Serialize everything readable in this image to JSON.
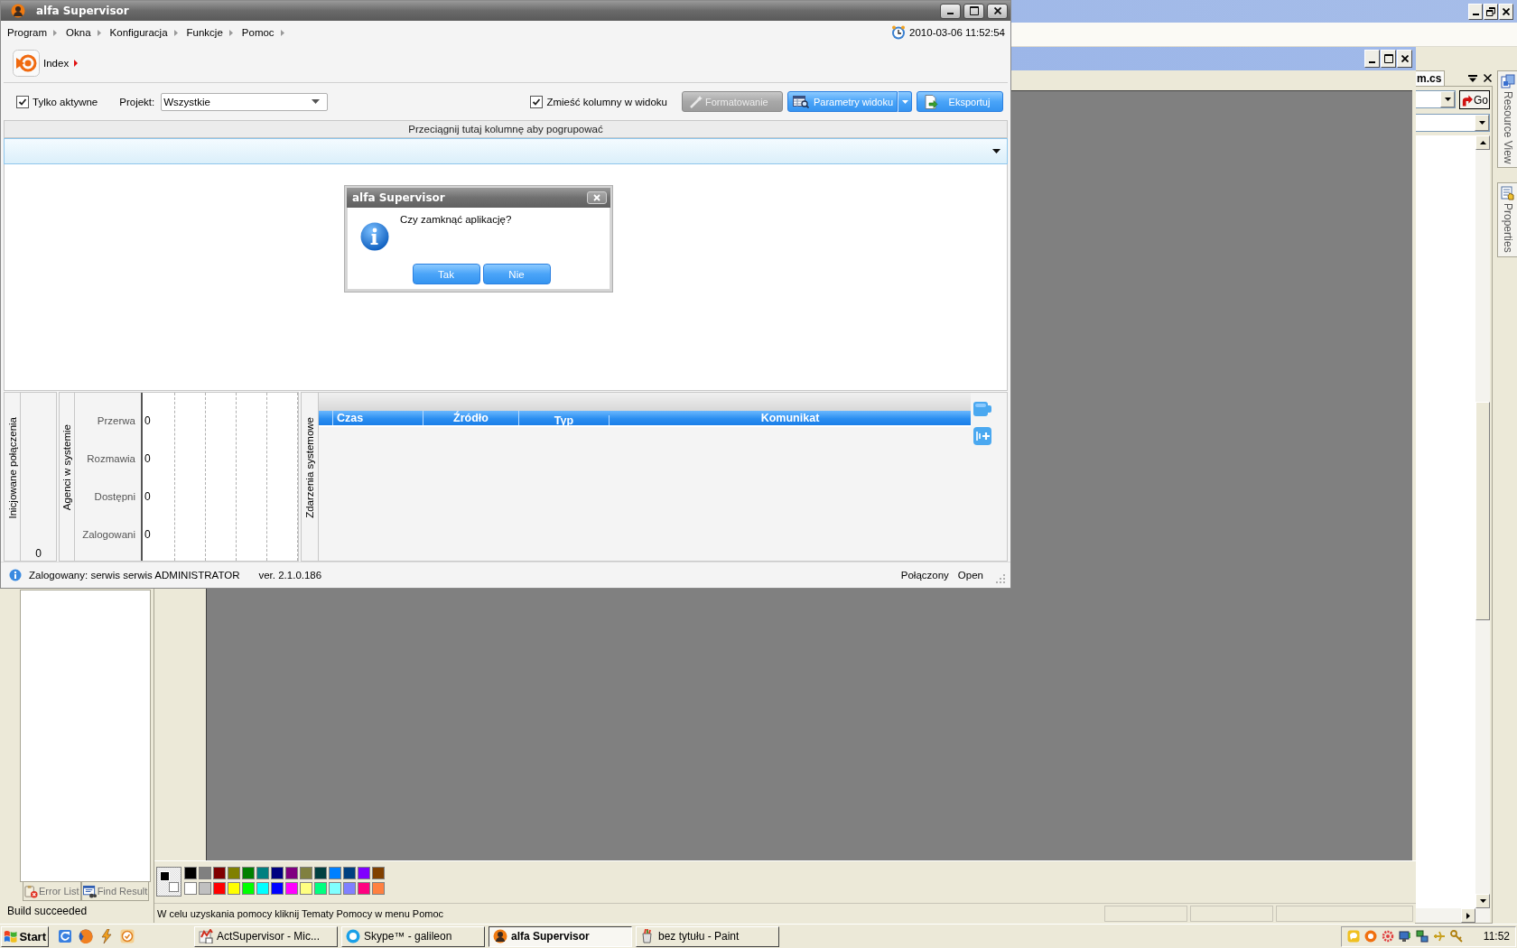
{
  "ide": {
    "document_tab": "m.cs",
    "go_button": "Go",
    "side_tabs": [
      {
        "label": "Resource View",
        "kind": "resources"
      },
      {
        "label": "Properties",
        "kind": "properties"
      }
    ],
    "bottom_tabs": [
      {
        "label": "Error List",
        "kind": "errors",
        "selected": false
      },
      {
        "label": "Find Result",
        "kind": "find",
        "selected": false
      }
    ],
    "status": "Build succeeded"
  },
  "paint": {
    "current_colors": [
      {
        "color": "#000000"
      },
      {
        "color": "#ffffff"
      }
    ],
    "palette": [
      {
        "color": "#000000"
      },
      {
        "color": "#808080"
      },
      {
        "color": "#800000"
      },
      {
        "color": "#808000"
      },
      {
        "color": "#008000"
      },
      {
        "color": "#008080"
      },
      {
        "color": "#000080"
      },
      {
        "color": "#800080"
      },
      {
        "color": "#808040"
      },
      {
        "color": "#004040"
      },
      {
        "color": "#0080ff"
      },
      {
        "color": "#004080"
      },
      {
        "color": "#8000ff"
      },
      {
        "color": "#804000"
      },
      {
        "color": "#ffffff"
      },
      {
        "color": "#c0c0c0"
      },
      {
        "color": "#ff0000"
      },
      {
        "color": "#ffff00"
      },
      {
        "color": "#00ff00"
      },
      {
        "color": "#00ffff"
      },
      {
        "color": "#0000ff"
      },
      {
        "color": "#ff00ff"
      },
      {
        "color": "#ffff80"
      },
      {
        "color": "#00ff80"
      },
      {
        "color": "#80ffff"
      },
      {
        "color": "#8080ff"
      },
      {
        "color": "#ff0080"
      },
      {
        "color": "#ff8040"
      }
    ],
    "status": "W celu uzyskania pomocy kliknij Tematy Pomocy w menu Pomoc"
  },
  "app": {
    "title": "alfa Supervisor",
    "menu": [
      "Program",
      "Okna",
      "Konfiguracja",
      "Funkcje",
      "Pomoc"
    ],
    "datetime": "2010-03-06 11:52:54",
    "breadcrumb": "Index",
    "toolbar": {
      "only_active": {
        "label": "Tylko aktywne",
        "checked": true
      },
      "project": {
        "label": "Projekt:",
        "value": "Wszystkie"
      },
      "fit_columns": {
        "label": "Zmieść kolumny w widoku",
        "checked": true
      },
      "buttons": [
        {
          "label": "Formatowanie",
          "kind": "format",
          "disabled": true,
          "split": false
        },
        {
          "label": "Parametry widoku",
          "kind": "view",
          "disabled": false,
          "split": true
        },
        {
          "label": "Eksportuj",
          "kind": "export",
          "disabled": false,
          "split": false
        }
      ]
    },
    "group_hint": "Przeciągnij tutaj kolumnę aby pogrupować",
    "initiated": {
      "title": "Inicjowane połączenia",
      "value": "0"
    },
    "agents": {
      "title": "Agenci w systemie",
      "rows": [
        {
          "label": "Przerwa",
          "value": "0"
        },
        {
          "label": "Rozmawia",
          "value": "0"
        },
        {
          "label": "Dostępni",
          "value": "0"
        },
        {
          "label": "Zalogowani",
          "value": "0"
        }
      ]
    },
    "events": {
      "title": "Zdarzenia systemowe",
      "columns": [
        "Czas",
        "Źródło",
        "Typ",
        "Komunikat"
      ]
    },
    "status_bar": {
      "user": "Zalogowany: serwis serwis ADMINISTRATOR",
      "version": "ver. 2.1.0.186",
      "connection": "Połączony",
      "mode": "Open"
    }
  },
  "dialog": {
    "title": "alfa Supervisor",
    "message": "Czy zamknąć aplikację?",
    "buttons": [
      "Tak",
      "Nie"
    ]
  },
  "taskbar": {
    "start": "Start",
    "tasks": [
      {
        "label": "ActSupervisor - Mic...",
        "kind": "ide",
        "selected": false
      },
      {
        "label": "Skype™ - galileon",
        "kind": "chat",
        "selected": false
      },
      {
        "label": "alfa Supervisor",
        "kind": "supervisor",
        "selected": true
      },
      {
        "label": "bez tytułu - Paint",
        "kind": "paint",
        "selected": false
      }
    ],
    "clock": "11:52"
  }
}
